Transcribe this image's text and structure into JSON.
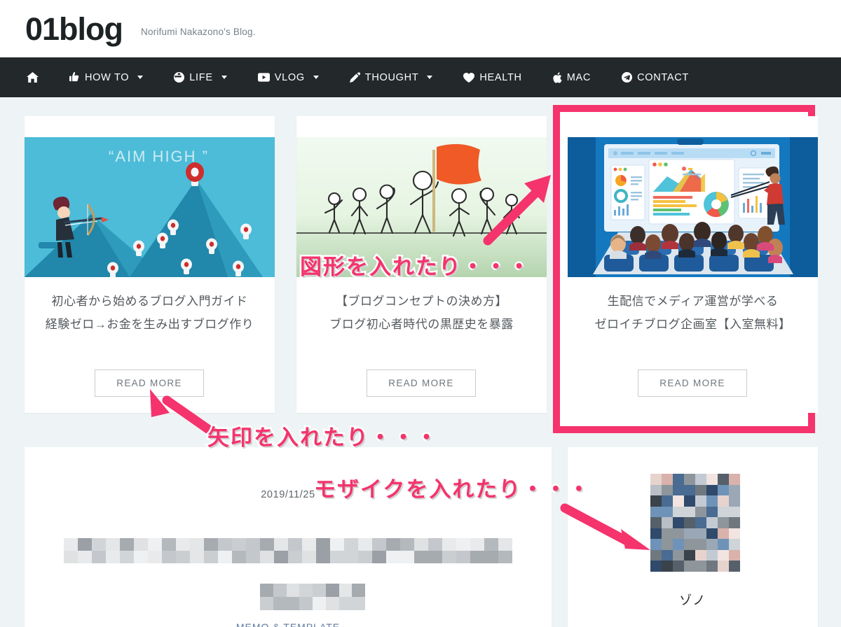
{
  "header": {
    "logo": "01blog",
    "tagline": "Norifumi Nakazono's Blog."
  },
  "nav": {
    "items": [
      {
        "label": "",
        "icon": "home-icon",
        "has_dropdown": false
      },
      {
        "label": "HOW TO",
        "icon": "thumbs-up-icon",
        "has_dropdown": true
      },
      {
        "label": "LIFE",
        "icon": "globe-icon",
        "has_dropdown": true
      },
      {
        "label": "VLOG",
        "icon": "youtube-icon",
        "has_dropdown": true
      },
      {
        "label": "THOUGHT",
        "icon": "pencil-icon",
        "has_dropdown": true
      },
      {
        "label": "HEALTH",
        "icon": "heart-icon",
        "has_dropdown": false
      },
      {
        "label": "MAC",
        "icon": "apple-icon",
        "has_dropdown": false
      },
      {
        "label": "CONTACT",
        "icon": "telegram-icon",
        "has_dropdown": false
      }
    ]
  },
  "cards": [
    {
      "title_line1": "初心者から始めるブログ入門ガイド",
      "title_line2": "経験ゼロ→お金を生み出すブログ作り",
      "button": "READ MORE",
      "thumb_caption": "“AIM HIGH ”",
      "thumb_alt": "archer-aiming-at-mountain-target-illustration"
    },
    {
      "title_line1": "【ブログコンセプトの決め方】",
      "title_line2": "ブログ初心者時代の黒歴史を暴露",
      "button": "READ MORE",
      "thumb_alt": "stick-figures-with-flag-illustration"
    },
    {
      "title_line1": "生配信でメディア運営が学べる",
      "title_line2": "ゼロイチブログ企画室【入室無料】",
      "button": "READ MORE",
      "thumb_alt": "seminar-presentation-dashboard-illustration",
      "highlighted": true,
      "highlight_color": "#f5336c"
    }
  ],
  "bottom_post": {
    "date": "2019/11/25",
    "title_redacted": "[mosaic-redacted-title]",
    "subtitle_redacted": "[mosaic-redacted-subtitle]",
    "category_link": "MEMO & TEMPLATE"
  },
  "author_card": {
    "avatar_alt": "[mosaic-redacted-avatar]",
    "name": "ゾノ"
  },
  "annotations": [
    {
      "text": "図形を入れたり・・・",
      "kind": "shape-annotation"
    },
    {
      "text": "矢印を入れたり・・・",
      "kind": "arrow-annotation"
    },
    {
      "text": "モザイクを入れたり・・・",
      "kind": "mosaic-annotation"
    }
  ],
  "colors": {
    "accent_pink": "#f5336c",
    "nav_bg": "#23282b",
    "page_bg": "#eef4f5",
    "link_blue": "#5d7a9e"
  }
}
